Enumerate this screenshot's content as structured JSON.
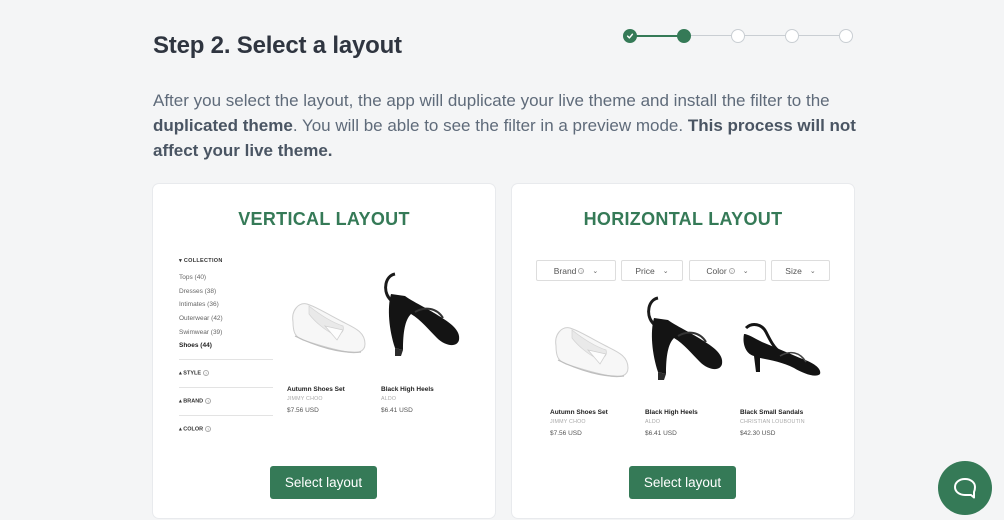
{
  "header": {
    "title": "Step 2. Select a layout"
  },
  "stepper": {
    "total": 5,
    "completed": 1,
    "current": 2
  },
  "description": {
    "part1": "After you select the layout, the app will duplicate your live theme and install the filter to the ",
    "bold1": "duplicated theme",
    "part2": ". You will be able to see the filter in a preview mode. ",
    "bold2": "This process will not affect your live theme."
  },
  "vertical_card": {
    "title": "VERTICAL LAYOUT",
    "button_label": "Select layout",
    "filter": {
      "collection_heading": "COLLECTION",
      "items": [
        "Tops (40)",
        "Dresses (38)",
        "Intimates (36)",
        "Outerwear (42)",
        "Swimwear (39)",
        "Shoes (44)"
      ],
      "selected_item": "Shoes (44)",
      "style_heading": "STYLE",
      "brand_heading": "BRAND",
      "color_heading": "COLOR"
    },
    "products": [
      {
        "name": "Autumn Shoes Set",
        "brand": "JIMMY CHOO",
        "price": "$7.56 USD"
      },
      {
        "name": "Black High Heels",
        "brand": "ALDO",
        "price": "$6.41 USD"
      }
    ]
  },
  "horizontal_card": {
    "title": "HORIZONTAL LAYOUT",
    "button_label": "Select layout",
    "filters": [
      "Brand",
      "Price",
      "Color",
      "Size"
    ],
    "products": [
      {
        "name": "Autumn Shoes Set",
        "brand": "JIMMY CHOO",
        "price": "$7.56 USD"
      },
      {
        "name": "Black High Heels",
        "brand": "ALDO",
        "price": "$6.41 USD"
      },
      {
        "name": "Black Small Sandals",
        "brand": "CHRISTIAN LOUBOUTIN",
        "price": "$42.30 USD"
      }
    ]
  },
  "colors": {
    "accent": "#357a57",
    "text": "#2f3540",
    "muted": "#5f6b7a",
    "background": "#f4f5f6"
  },
  "icons": {
    "check": "check-icon",
    "chat": "chat-bubble-icon",
    "help": "question-mark-icon",
    "chevron": "chevron-down-icon"
  }
}
